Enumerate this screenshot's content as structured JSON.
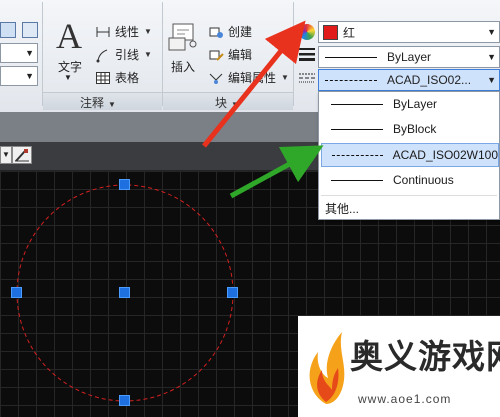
{
  "ribbon": {
    "annotation_panel": {
      "title": "注释",
      "text_label": "文字",
      "linear_label": "线性",
      "leader_label": "引线",
      "table_label": "表格"
    },
    "block_panel": {
      "title": "块",
      "insert_label": "插入",
      "create_label": "创建",
      "edit_label": "编辑",
      "edit_attr_label": "编辑属性"
    },
    "properties_panel": {
      "color_value": "红",
      "color_swatch": "#e11a1a",
      "lineweight_value": "ByLayer",
      "linetype_value": "ACAD_ISO02..."
    }
  },
  "linetype_dropdown": {
    "items": [
      {
        "label": "ByLayer",
        "style": "solid",
        "selected": false
      },
      {
        "label": "ByBlock",
        "style": "solid",
        "selected": false
      },
      {
        "label": "ACAD_ISO02W100",
        "style": "dashed",
        "selected": true
      },
      {
        "label": "Continuous",
        "style": "solid",
        "selected": false
      }
    ],
    "other_label": "其他..."
  },
  "drawing": {
    "circle_color": "#d42020",
    "grip_color": "#1e6fe0"
  },
  "watermark": {
    "title": "奥义游戏网",
    "url": "www.aoe1.com"
  },
  "arrows": {
    "red": "#e8321e",
    "green": "#2fa82a"
  }
}
